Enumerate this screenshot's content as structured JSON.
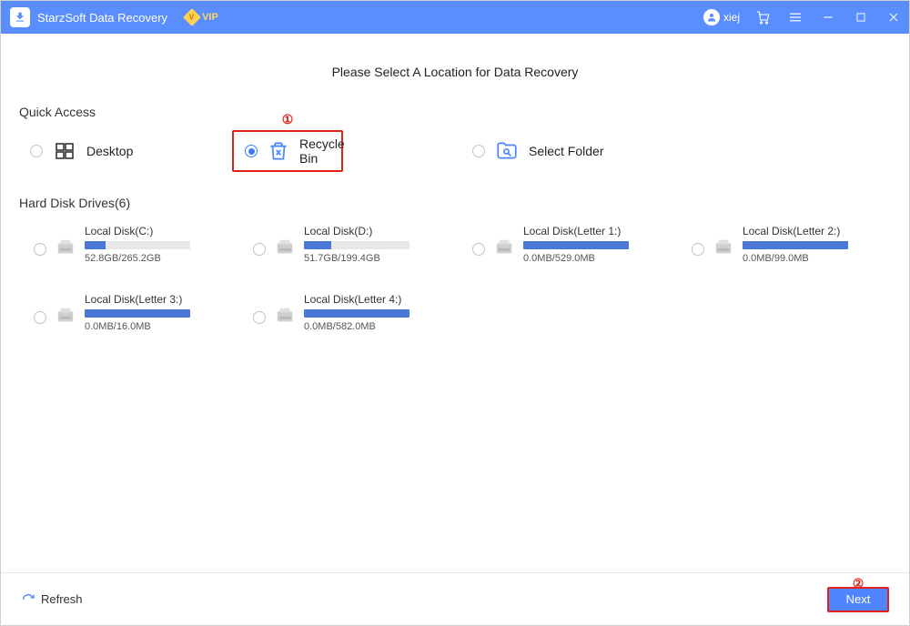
{
  "titlebar": {
    "app_name": "StarzSoft Data Recovery",
    "vip_label": "VIP",
    "user_name": "xiej"
  },
  "heading": "Please Select A Location for Data Recovery",
  "sections": {
    "quick_title": "Quick Access",
    "drives_title": "Hard Disk Drives(6)"
  },
  "quick_access": [
    {
      "label": "Desktop",
      "icon": "windows",
      "selected": false
    },
    {
      "label": "Recycle Bin",
      "icon": "recycle",
      "selected": true,
      "highlighted": true
    },
    {
      "label": "Select Folder",
      "icon": "search-folder",
      "selected": false
    }
  ],
  "drives": [
    {
      "name": "Local Disk(C:)",
      "usage": "52.8GB/265.2GB",
      "fill": 20
    },
    {
      "name": "Local Disk(D:)",
      "usage": "51.7GB/199.4GB",
      "fill": 26
    },
    {
      "name": "Local Disk(Letter 1:)",
      "usage": "0.0MB/529.0MB",
      "fill": 100
    },
    {
      "name": "Local Disk(Letter 2:)",
      "usage": "0.0MB/99.0MB",
      "fill": 100
    },
    {
      "name": "Local Disk(Letter 3:)",
      "usage": "0.0MB/16.0MB",
      "fill": 100
    },
    {
      "name": "Local Disk(Letter 4:)",
      "usage": "0.0MB/582.0MB",
      "fill": 100
    }
  ],
  "footer": {
    "refresh_label": "Refresh",
    "next_label": "Next"
  },
  "annotations": {
    "a1": "①",
    "a2": "②"
  }
}
